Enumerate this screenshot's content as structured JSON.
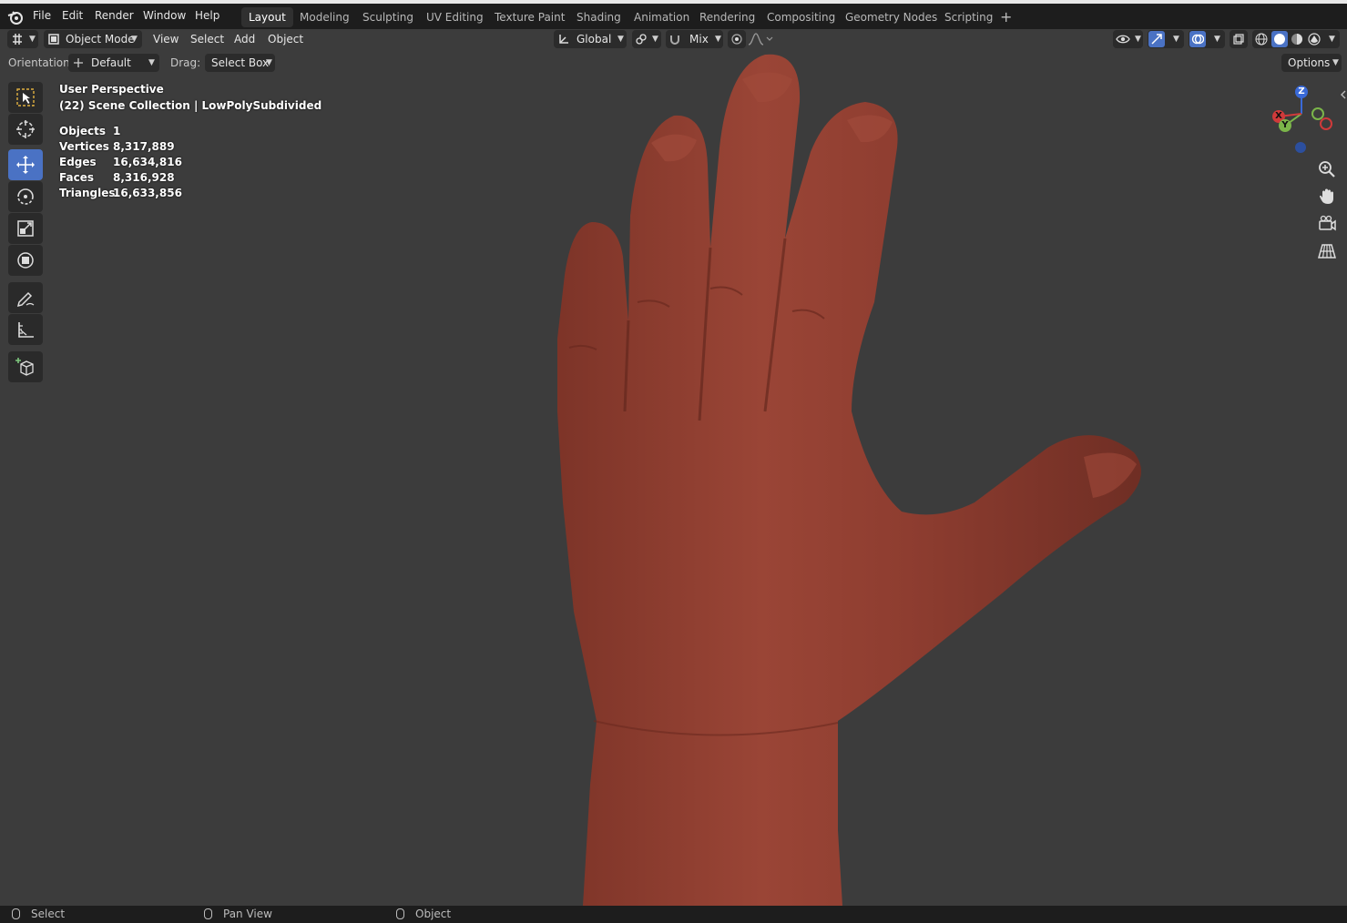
{
  "menubar": {
    "items": [
      "File",
      "Edit",
      "Render",
      "Window",
      "Help"
    ],
    "workspace_tabs": [
      "Layout",
      "Modeling",
      "Sculpting",
      "UV Editing",
      "Texture Paint",
      "Shading",
      "Animation",
      "Rendering",
      "Compositing",
      "Geometry Nodes",
      "Scripting"
    ],
    "active_tab": "Layout",
    "add_tab_label": "+"
  },
  "viewport_header": {
    "mode": "Object Mode",
    "menus": [
      "View",
      "Select",
      "Add",
      "Object"
    ],
    "transform_orientation": "Global",
    "snap_mode": "Mix",
    "options_label": "Options"
  },
  "tool_settings": {
    "orientation_label": "Orientation:",
    "orientation_value": "Default",
    "drag_label": "Drag:",
    "drag_value": "Select Box"
  },
  "overlay": {
    "view_name": "User Perspective",
    "collection": "(22) Scene Collection | LowPolySubdivided",
    "stats": [
      {
        "label": "Objects",
        "value": "1"
      },
      {
        "label": "Vertices",
        "value": "8,317,889"
      },
      {
        "label": "Edges",
        "value": "16,634,816"
      },
      {
        "label": "Faces",
        "value": "8,316,928"
      },
      {
        "label": "Triangles",
        "value": "16,633,856"
      }
    ]
  },
  "gizmo": {
    "x": "X",
    "y": "Y",
    "z": "Z"
  },
  "statusbar": {
    "items": [
      "Select",
      "Pan View",
      "Object"
    ]
  },
  "colors": {
    "accent": "#4a72c4",
    "viewport_bg": "#3c3c3c",
    "mesh": "#8e3b2e"
  }
}
